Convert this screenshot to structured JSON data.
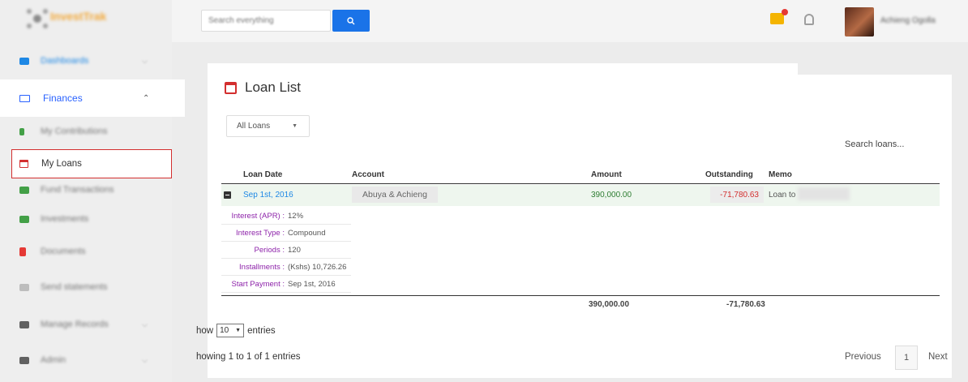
{
  "topbar": {
    "search_placeholder": "Search everything",
    "user_name": "Achieng Ogolla"
  },
  "sidebar": {
    "brand": "InvestTrak",
    "items": [
      {
        "label": "Dashboards",
        "icon": "dashboard-icon",
        "color": "#1e88e5"
      },
      {
        "label": "Finances",
        "icon": "money-icon",
        "color": "#2962ff"
      },
      {
        "label": "My Contributions",
        "icon": "contributions-icon",
        "color": "#43a047"
      },
      {
        "label": "My Loans",
        "icon": "calendar-icon",
        "color": "#d32f2f"
      },
      {
        "label": "Fund Transactions",
        "icon": "transactions-icon",
        "color": "#43a047"
      },
      {
        "label": "Investments",
        "icon": "investments-icon",
        "color": "#43a047"
      },
      {
        "label": "Documents",
        "icon": "documents-icon",
        "color": "#e53935"
      },
      {
        "label": "Send statements",
        "icon": "statements-icon",
        "color": "#9e9e9e"
      },
      {
        "label": "Manage Records",
        "icon": "records-icon",
        "color": "#616161"
      },
      {
        "label": "Admin",
        "icon": "admin-icon",
        "color": "#616161"
      }
    ]
  },
  "main": {
    "title": "Loan List",
    "filter_value": "All Loans",
    "search_loans": "Search loans...",
    "columns": [
      "Loan Date",
      "Account",
      "Amount",
      "Outstanding",
      "Memo"
    ],
    "row": {
      "loan_date": "Sep 1st, 2016",
      "account": "Abuya & Achieng",
      "amount": "390,000.00",
      "outstanding": "-71,780.63",
      "memo": "Loan to"
    },
    "details": [
      {
        "key": "Interest (APR) :",
        "value": "12%"
      },
      {
        "key": "Interest Type :",
        "value": "Compound"
      },
      {
        "key": "Periods :",
        "value": "120"
      },
      {
        "key": "Installments :",
        "value": "(Kshs) 10,726.26"
      },
      {
        "key": "Start Payment :",
        "value": "Sep 1st, 2016"
      }
    ],
    "totals": {
      "amount": "390,000.00",
      "outstanding": "-71,780.63"
    },
    "show_prefix": "how",
    "entries_value": "10",
    "entries_suffix": "entries",
    "showing_text": "howing 1 to 1 of 1 entries",
    "pagination": {
      "previous": "Previous",
      "page": "1",
      "next": "Next"
    }
  }
}
